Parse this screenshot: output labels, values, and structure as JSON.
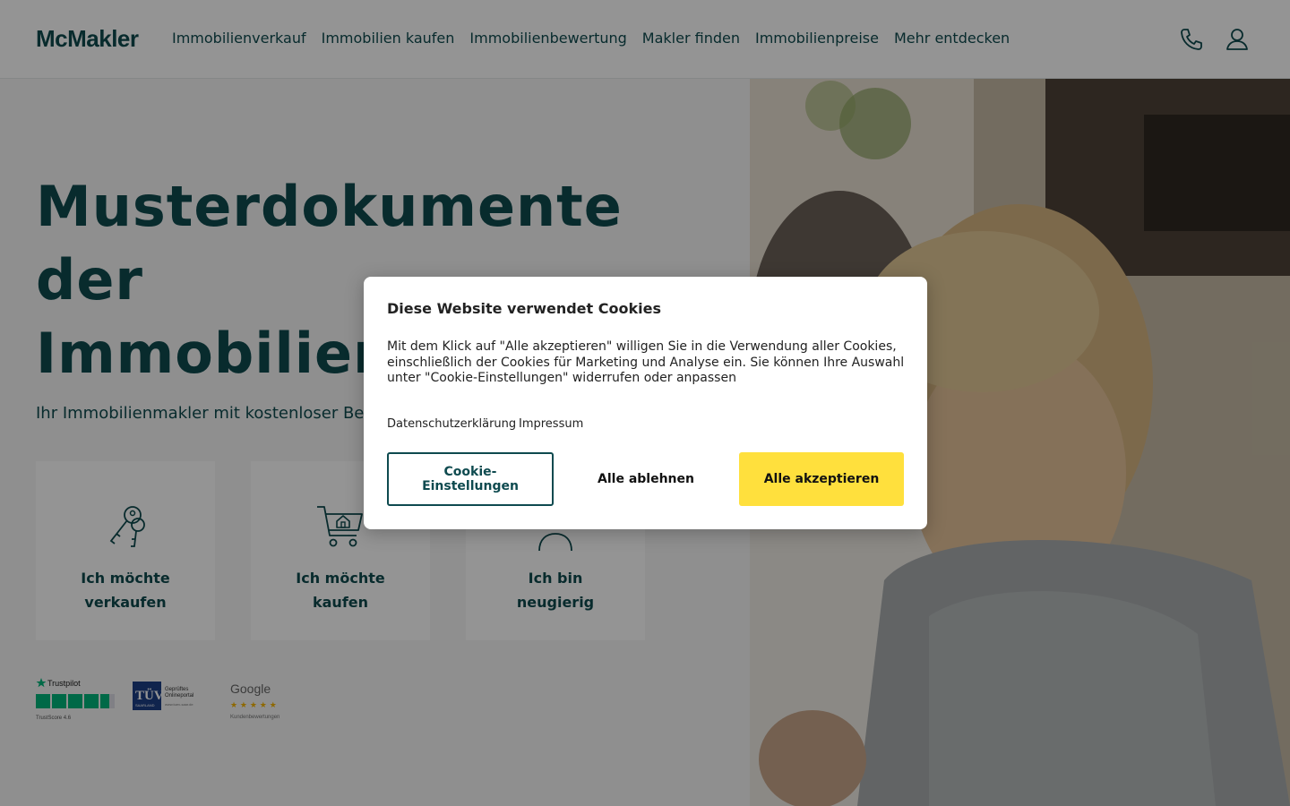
{
  "brand": {
    "logo": "McMakler"
  },
  "nav": [
    {
      "label": "Immobilienverkauf"
    },
    {
      "label": "Immobilien kaufen"
    },
    {
      "label": "Immobilienbewertung"
    },
    {
      "label": "Makler finden"
    },
    {
      "label": "Immobilienpreise"
    },
    {
      "label": "Mehr entdecken"
    }
  ],
  "header_icons": {
    "phone": "phone-icon",
    "account": "user-icon"
  },
  "hero": {
    "title_lines": [
      "Musterdokumente",
      "der",
      "Immobilien"
    ],
    "subtitle": "Ihr Immobilienmakler mit kostenloser Be",
    "cards": [
      {
        "icon": "keys-icon",
        "line1": "Ich möchte",
        "line2": "verkaufen"
      },
      {
        "icon": "shopping-cart-house-icon",
        "line1": "Ich möchte",
        "line2": "kaufen"
      },
      {
        "icon": "person-icon",
        "line1": "Ich bin",
        "line2": "neugierig"
      }
    ]
  },
  "badges": {
    "trustpilot": {
      "name": "Trustpilot",
      "score": "TrustScore 4.6"
    },
    "tuv": {
      "mark": "TÜV",
      "sub": "SAARLAND",
      "line1": "Geprüftes",
      "line2": "Onlineportal",
      "line3": "www.tuev-saar.de"
    },
    "google": {
      "name": "Google",
      "caption": "Kundenbewertungen"
    }
  },
  "cookie_modal": {
    "title": "Diese Website verwendet Cookies",
    "text": "Mit dem Klick auf \"Alle akzeptieren\" willigen Sie in die Verwendung aller Cookies, einschließlich der Cookies für Marketing und Analyse ein. Sie können Ihre Auswahl unter \"Cookie-Einstellungen\" widerrufen oder anpassen",
    "links": {
      "privacy": "Datenschutzerklärung",
      "imprint": "Impressum"
    },
    "buttons": {
      "settings": "Cookie-Einstellungen",
      "reject": "Alle ablehnen",
      "accept": "Alle akzeptieren"
    }
  },
  "colors": {
    "brand_teal": "#0e4a4f",
    "accent_yellow": "#ffe03d",
    "overlay": "rgba(0,0,0,0.42)"
  }
}
